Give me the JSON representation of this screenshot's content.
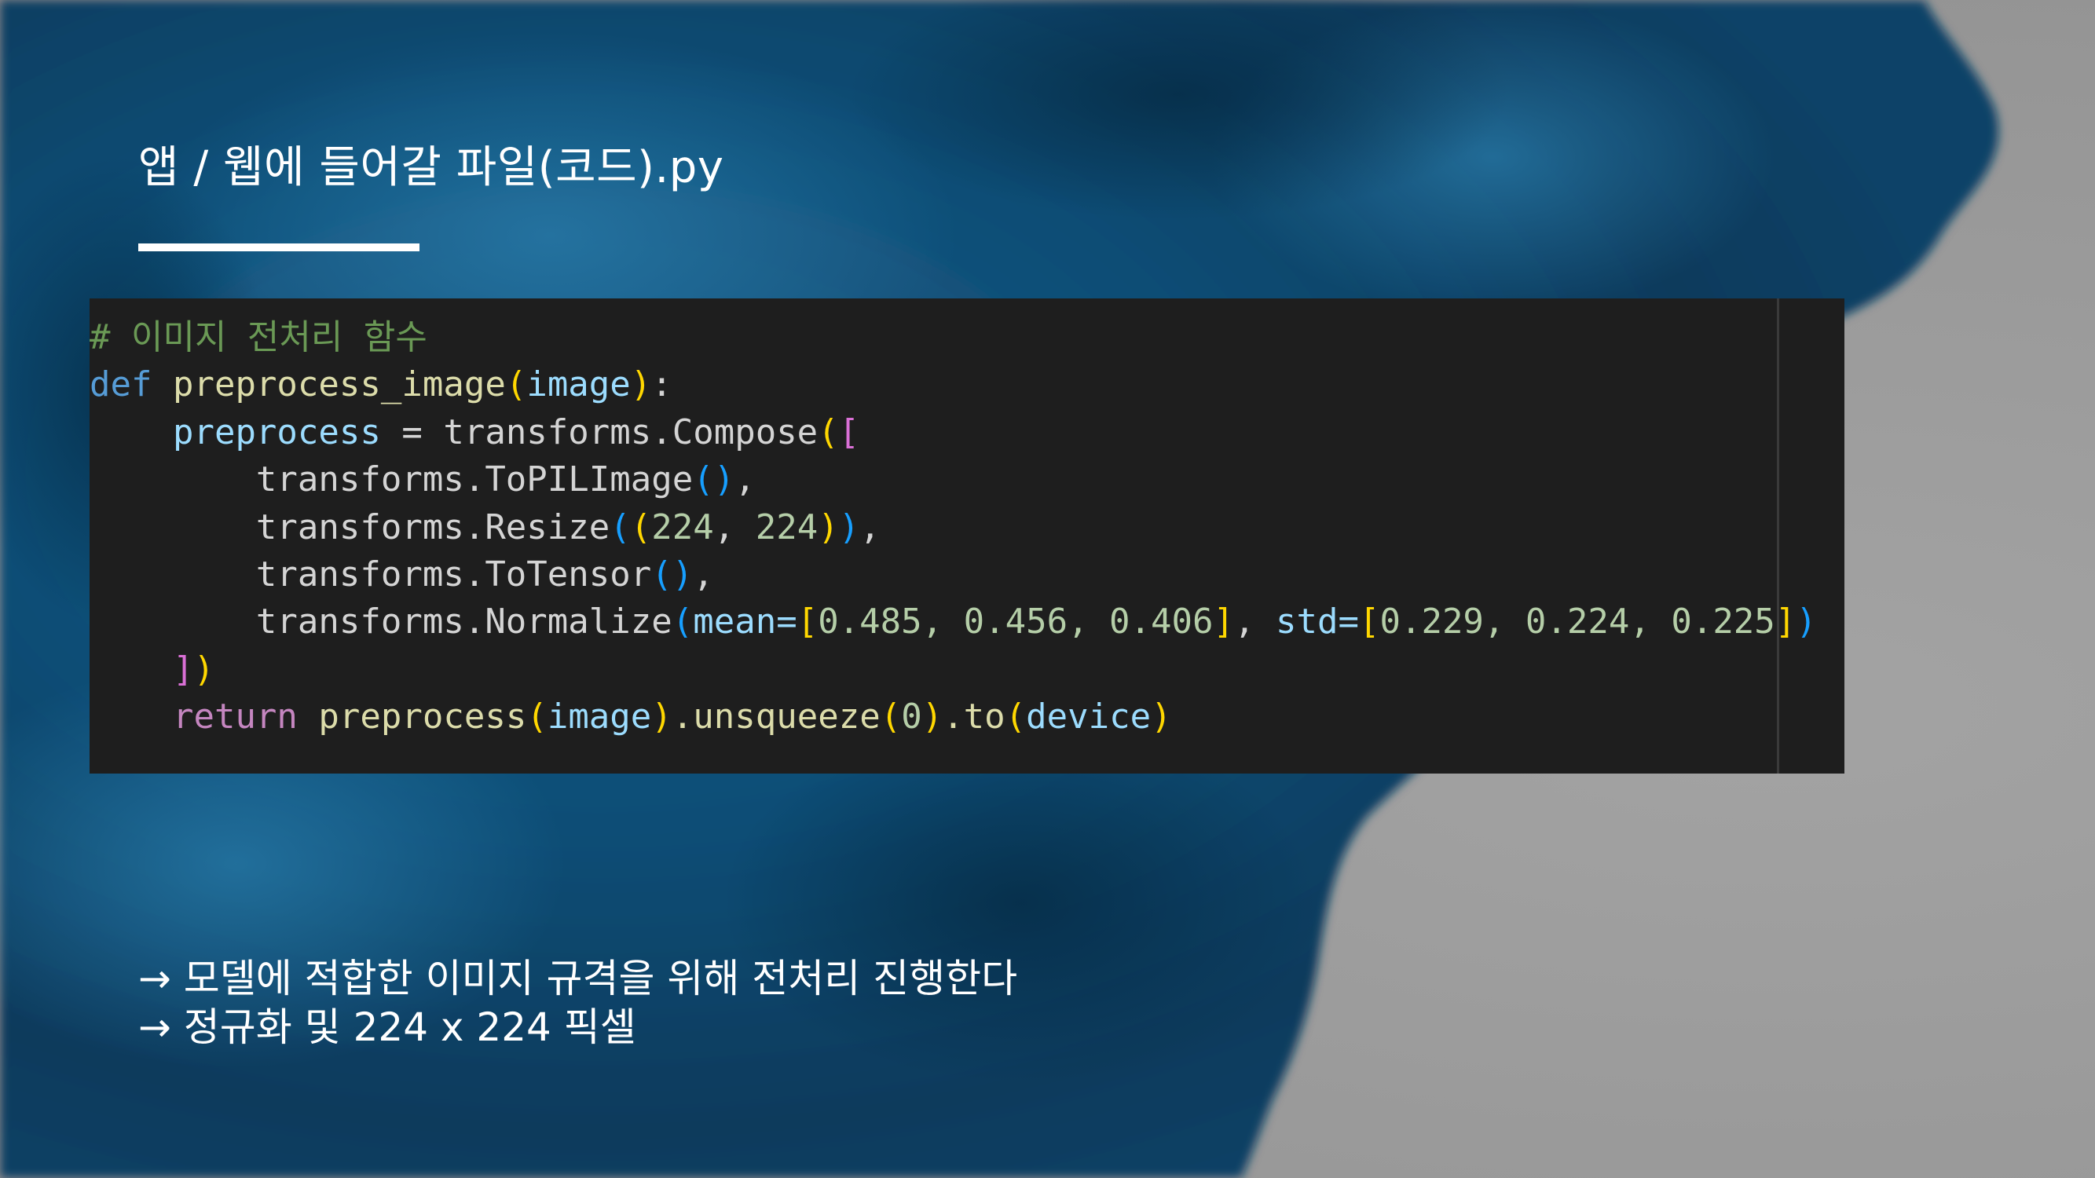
{
  "slide": {
    "title": "앱 / 웹에 들어갈 파일(코드).py"
  },
  "code": {
    "comment": "# 이미지 전처리 함수",
    "def_kw": "def",
    "func_name": "preprocess_image",
    "param": "image",
    "return_kw": "return",
    "lines": {
      "l2_var": "preprocess",
      "l2_rest": " = transforms.Compose",
      "l3": "transforms.ToPILImage",
      "l4": "transforms.Resize",
      "l4_a": "224",
      "l4_b": "224",
      "l5": "transforms.ToTensor",
      "l6_fn": "transforms.Normalize",
      "l6_mean_kw": "mean=",
      "l6_mean": "0.485, 0.456, 0.406",
      "l6_std_kw": "std=",
      "l6_std": "0.229, 0.224, 0.225",
      "l8_call": "preprocess",
      "l8_arg": "image",
      "l8_mid": ".unsqueeze",
      "l8_zero": "0",
      "l8_to": ".to",
      "l8_dev": "device"
    }
  },
  "notes": [
    "→ 모델에 적합한 이미지 규격을 위해 전처리 진행한다",
    "→ 정규화 및 224 x 224 픽셀"
  ],
  "colors": {
    "background_blue": "#0d4a6e",
    "background_gray": "#9c9c9c",
    "code_bg": "#1e1e1e"
  }
}
